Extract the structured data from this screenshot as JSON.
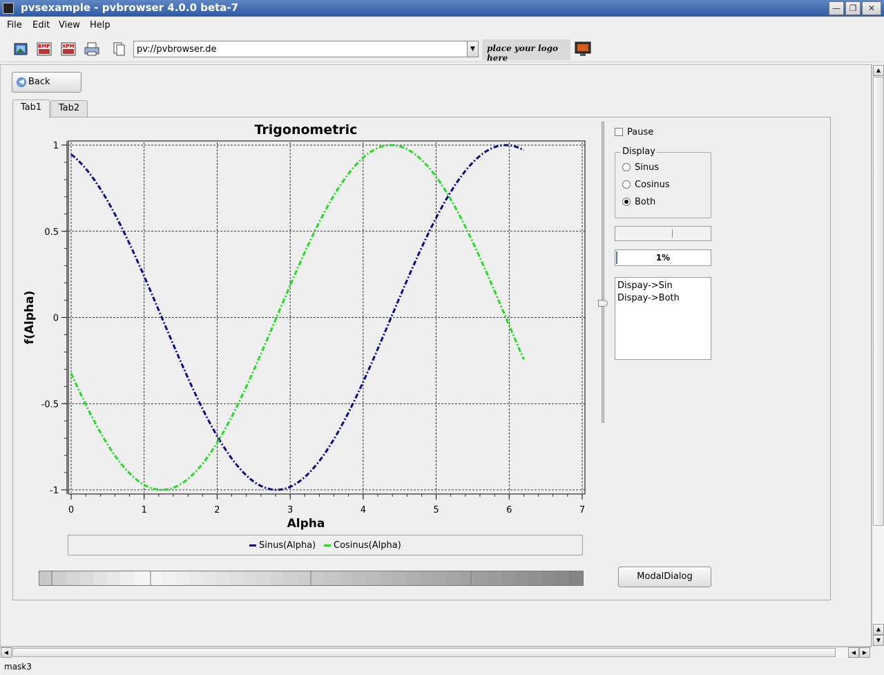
{
  "window": {
    "title": "pvsexample - pvbrowser 4.0.0 beta-7",
    "controls": [
      "minimize",
      "restore",
      "close"
    ]
  },
  "menubar": {
    "items": [
      "File",
      "Edit",
      "View",
      "Help"
    ]
  },
  "toolbar": {
    "url": "pv://pvbrowser.de",
    "logo_text": "place your logo here",
    "icons": [
      "image-icon",
      "bmp-icon",
      "xpm-icon",
      "print-icon",
      "copy-icon",
      "monitor-icon"
    ]
  },
  "back_button": {
    "label": "Back"
  },
  "tabs": [
    {
      "label": "Tab1",
      "active": true
    },
    {
      "label": "Tab2",
      "active": false
    }
  ],
  "right_panel": {
    "pause_label": "Pause",
    "pause_checked": false,
    "display_group_title": "Display",
    "radios": [
      {
        "label": "Sinus",
        "checked": false
      },
      {
        "label": "Cosinus",
        "checked": false
      },
      {
        "label": "Both",
        "checked": true
      }
    ],
    "progress_value": 1,
    "progress_text": "1%",
    "log_lines": [
      "Dispay->Sin",
      "Dispay->Both"
    ],
    "modal_button_label": "ModalDialog"
  },
  "status": {
    "text": "mask3"
  },
  "chart_data": {
    "type": "line",
    "title": "Trigonometric",
    "xlabel": "Alpha",
    "ylabel": "f(Alpha)",
    "xlim": [
      0,
      7
    ],
    "ylim": [
      -1,
      1
    ],
    "xticks": [
      0,
      1,
      2,
      3,
      4,
      5,
      6,
      7
    ],
    "yticks": [
      1,
      0.5,
      0,
      -0.5,
      -1
    ],
    "ytick_labels": [
      "1",
      "0.5",
      "0",
      "-0.5",
      "-1"
    ],
    "grid": true,
    "legend": "bottom",
    "series": [
      {
        "name": "Sinus(Alpha)",
        "color": "#0a0a8c",
        "function": "sin",
        "phase": 1.9,
        "x_start": 0,
        "x_end": 6.2,
        "step": 0.1
      },
      {
        "name": "Cosinus(Alpha)",
        "color": "#22dd22",
        "function": "cos",
        "phase": 1.9,
        "x_start": 0,
        "x_end": 6.2,
        "step": 0.1
      }
    ]
  }
}
